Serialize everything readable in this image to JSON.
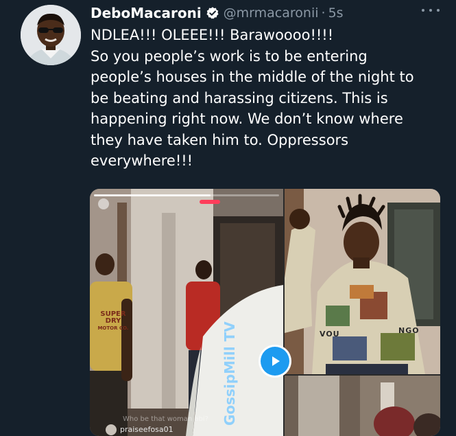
{
  "tweet": {
    "author_name": "DeboMacaroni",
    "handle": "@mrmacaronii",
    "separator": "·",
    "time": "5s",
    "verified": true,
    "lines": [
      "NDLEA!!! OLEEE!!! Barawoooo!!!!",
      "So you people’s work is to be entering",
      "people’s houses in the middle of the night to",
      "be beating and harassing citizens. This is",
      "happening right now. We don’t know where",
      "they have taken him to. Oppressors",
      "everywhere!!!"
    ]
  },
  "media": {
    "shirt_text_1": "SUPER",
    "shirt_text_2": "DRY",
    "shirt_text_3": "MOTOR CO.",
    "caption": "Who be that woman abi?",
    "username": "praiseefosa01",
    "watermark": "GossipMill TV",
    "sweater_text_1": "VOU",
    "sweater_text_2": "NGO"
  },
  "colors": {
    "background": "#15202b",
    "secondary_text": "#8b98a5",
    "accent": "#1d9bf0"
  },
  "icons": {
    "verified": "verified-badge-icon",
    "more": "more-options-icon",
    "play": "play-icon"
  }
}
